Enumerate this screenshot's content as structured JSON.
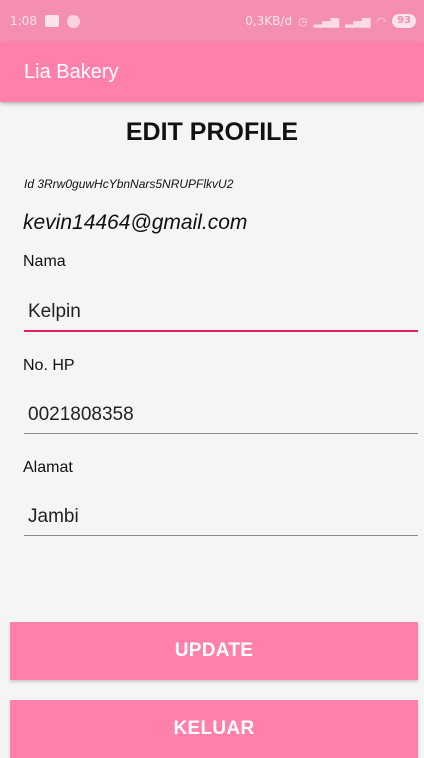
{
  "status_bar": {
    "time": "1:08",
    "network_speed": "0,3KB/d",
    "battery": "93"
  },
  "app_bar": {
    "title": "Lia Bakery"
  },
  "page": {
    "title": "EDIT PROFILE",
    "user_id": "Id 3Rrw0guwHcYbnNars5NRUPFlkvU2",
    "email": "kevin14464@gmail.com"
  },
  "form": {
    "name_label": "Nama",
    "name_value": "Kelpin",
    "phone_label": "No. HP",
    "phone_value": "0021808358",
    "address_label": "Alamat",
    "address_value": "Jambi"
  },
  "buttons": {
    "update": "UPDATE",
    "logout": "KELUAR"
  },
  "colors": {
    "primary": "#ff80ab",
    "status_bar": "#f48fb1",
    "accent": "#e91e63"
  }
}
